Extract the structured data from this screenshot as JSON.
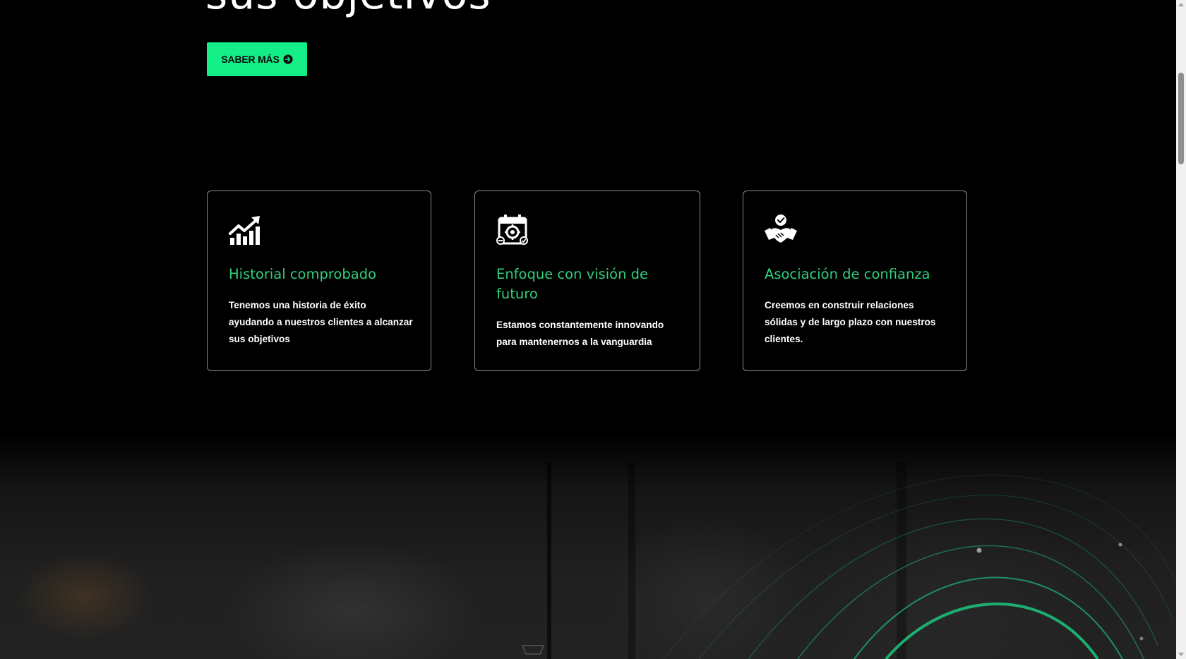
{
  "hero": {
    "heading": "sus objetivos",
    "cta_label": "SABER MÁS"
  },
  "features": [
    {
      "icon": "chart-growth-icon",
      "title": "Historial comprobado",
      "text": "Tenemos una historia de éxito ayudando a nuestros clientes a alcanzar sus objetivos"
    },
    {
      "icon": "calendar-gear-icon",
      "title": "Enfoque con visión de futuro",
      "text": "Estamos constantemente innovando para mantenernos a la vanguardia"
    },
    {
      "icon": "handshake-check-icon",
      "title": "Asociación de confianza",
      "text": "Creemos en construir relaciones sólidas y de largo plazo con nuestros clientes."
    }
  ],
  "colors": {
    "accent": "#14ee86",
    "title_green": "#2fd07c",
    "background": "#000000"
  }
}
